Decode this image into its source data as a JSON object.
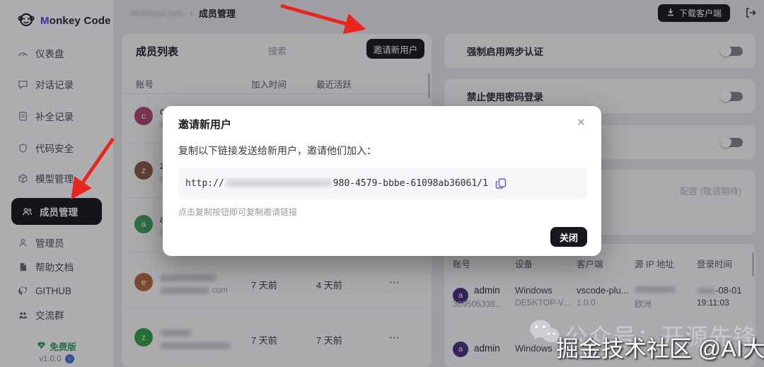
{
  "brand": {
    "first_letter": "M",
    "rest": "onkey Code"
  },
  "sidebar": {
    "items": [
      {
        "label": "仪表盘"
      },
      {
        "label": "对话记录"
      },
      {
        "label": "补全记录"
      },
      {
        "label": "代码安全"
      },
      {
        "label": "模型管理"
      },
      {
        "label": "成员管理"
      },
      {
        "label": "管理员"
      },
      {
        "label": "帮助文档"
      },
      {
        "label": "GITHUB"
      },
      {
        "label": "交流群"
      }
    ],
    "plan_badge": "免费版",
    "version": "v1.0.0"
  },
  "topbar": {
    "breadcrumb_root": "MonkeyCode",
    "breadcrumb_sep": "›",
    "breadcrumb_current": "成员管理",
    "download_button": "下载客户端"
  },
  "members": {
    "title": "成员列表",
    "search_placeholder": "搜索",
    "invite_button": "邀请新用户",
    "col_account": "账号",
    "col_joined": "加入时间",
    "col_active": "最近活跃",
    "rows": [
      {
        "avatar_letter": "c",
        "name": "chan"
      },
      {
        "avatar_letter": "z",
        "name": "zyhm"
      },
      {
        "avatar_letter": "a",
        "name": "abcd"
      },
      {
        "avatar_letter": "e",
        "email_suffix": "com",
        "joined": "7 天前",
        "last_active": "4 天前",
        "menu": "⋯"
      },
      {
        "avatar_letter": "z",
        "joined": "7 天前",
        "last_active": "7 天前",
        "menu": "⋯"
      }
    ]
  },
  "settings": {
    "toggle_2fa": "强制启用两步认证",
    "toggle_password": "禁止使用密码登录",
    "config_note": "配置 (敬请期待)"
  },
  "logins": {
    "col_account": "账号",
    "col_device": "设备",
    "col_client": "客户端",
    "col_ip": "源 IP 地址",
    "col_time": "登录时间",
    "rows": [
      {
        "avatar_letter": "a",
        "name": "admin",
        "account_sub": "309505338...",
        "device": "Windows",
        "device_sub": "DESKTOP-V...",
        "client": "vscode-plu...",
        "client_sub": "1.0.0",
        "region": "欧洲",
        "date_suffix": "-08-01",
        "time": "19:11:03"
      },
      {
        "avatar_letter": "a",
        "name": "admin",
        "device": "Windows"
      }
    ]
  },
  "modal": {
    "title": "邀请新用户",
    "close_icon": "✕",
    "description": "复制以下链接发送给新用户，邀请他们加入：",
    "link_prefix": "http://",
    "link_visible": "980-4579-bbbe-61098ab36061/1",
    "hint": "点击复制按钮即可复制邀请链接",
    "close_button": "关闭"
  },
  "watermark": {
    "back_text": "公众号：开源先锋",
    "front_text": "掘金技术社区 @AI大牛"
  },
  "colors": {
    "accent": "#5147e5",
    "dark_button": "#17171f",
    "plan_green": "#2e9e5b",
    "arrow_red": "#e8251f",
    "copy_purple": "#6a5ae0"
  }
}
